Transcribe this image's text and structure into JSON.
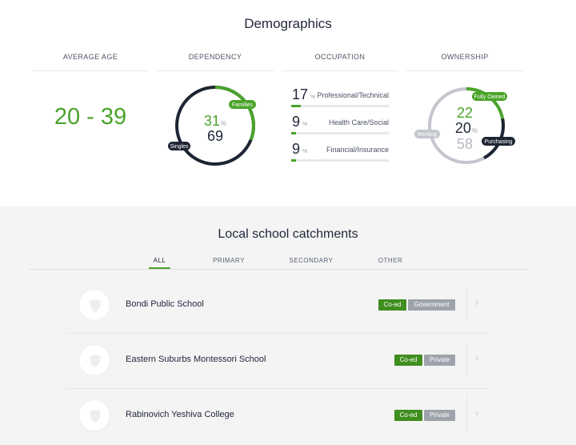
{
  "demographics": {
    "title": "Demographics",
    "columns": {
      "average_age": "AVERAGE AGE",
      "dependency": "DEPENDENCY",
      "occupation": "OCCUPATION",
      "ownership": "OWNERSHIP"
    },
    "age_range": "20 - 39",
    "dependency": {
      "primary_value": "31",
      "primary_pct": "%",
      "secondary_value": "69",
      "labels": {
        "families": "Families",
        "singles": "Singles"
      },
      "families_share": 0.31,
      "colors": {
        "families": "#4aa32a",
        "singles": "#1d2433"
      }
    },
    "occupation": [
      {
        "value": "17",
        "pct": "%",
        "label": "Professional/Technical",
        "share": 0.17
      },
      {
        "value": "9",
        "pct": "%",
        "label": "Health Care/Social",
        "share": 0.09
      },
      {
        "value": "9",
        "pct": "%",
        "label": "Financial/Insurance",
        "share": 0.09
      }
    ],
    "ownership": {
      "fully_owned": "22",
      "purchasing": "20",
      "pct": "%",
      "renting": "58",
      "labels": {
        "fully_owned": "Fully Owned",
        "purchasing": "Purchasing",
        "renting": "Renting"
      },
      "shares": {
        "fully_owned": 0.22,
        "purchasing": 0.2,
        "renting": 0.58
      },
      "colors": {
        "fully_owned": "#4aa32a",
        "purchasing": "#1d2433",
        "renting": "#c3c6cc"
      }
    }
  },
  "schools": {
    "title": "Local school catchments",
    "tabs": [
      {
        "label": "ALL",
        "active": true
      },
      {
        "label": "PRIMARY",
        "active": false
      },
      {
        "label": "SECONDARY",
        "active": false
      },
      {
        "label": "OTHER",
        "active": false
      }
    ],
    "list": [
      {
        "name": "Bondi Public School",
        "badges": [
          "Co-ed",
          "Government"
        ]
      },
      {
        "name": "Eastern Suburbs Montessori School",
        "badges": [
          "Co-ed",
          "Private"
        ]
      },
      {
        "name": "Rabinovich Yeshiva College",
        "badges": [
          "Co-ed",
          "Private"
        ]
      }
    ],
    "icons": {
      "avatar": "school-crest-icon",
      "row_action": "chevron-right-icon"
    }
  }
}
